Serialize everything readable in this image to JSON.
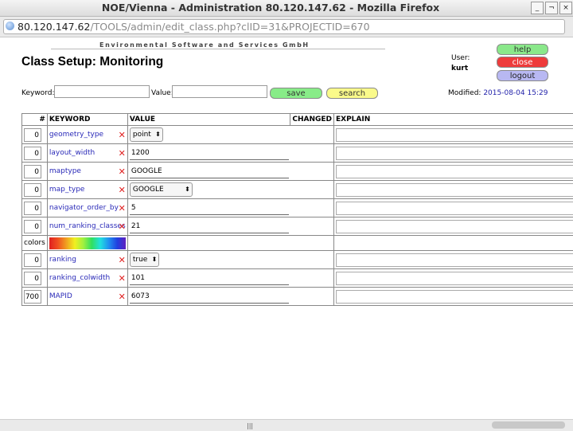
{
  "window": {
    "title": "NOE/Vienna - Administration 80.120.147.62 - Mozilla Firefox",
    "url_host": "80.120.147.62",
    "url_path": "/TOOLS/admin/edit_class.php?clID=31&PROJECTID=670",
    "controls": {
      "minimize": "_",
      "maximize": "¬",
      "close": "×"
    }
  },
  "header": {
    "company": "Environmental Software and Services GmbH",
    "title": "Class Setup: Monitoring",
    "user_label": "User:",
    "user_name": "kurt"
  },
  "buttons": {
    "help": "help",
    "close": "close",
    "logout": "logout",
    "save": "save",
    "search": "search"
  },
  "search": {
    "keyword_label": "Keyword:",
    "keyword_value": "",
    "value_label": "Value:",
    "value_value": ""
  },
  "modified": {
    "label": "Modified:",
    "date": "2015-08-04 15:29"
  },
  "table": {
    "headers": {
      "num": "#",
      "keyword": "KEYWORD",
      "value": "VALUE",
      "changed": "CHANGED",
      "explain": "EXPLAIN"
    },
    "rows": [
      {
        "order": "0",
        "keyword": "geometry_type",
        "value": "point"
      },
      {
        "order": "0",
        "keyword": "layout_width",
        "value": "1200"
      },
      {
        "order": "0",
        "keyword": "maptype",
        "value": "GOOGLE"
      },
      {
        "order": "0",
        "keyword": "map_type",
        "value": "GOOGLE"
      },
      {
        "order": "0",
        "keyword": "navigator_order_by",
        "value": "5"
      },
      {
        "order": "0",
        "keyword": "num_ranking_classes",
        "value": "21"
      },
      {
        "label": "colors"
      },
      {
        "order": "0",
        "keyword": "ranking",
        "value": "true"
      },
      {
        "order": "0",
        "keyword": "ranking_colwidth",
        "value": "101"
      },
      {
        "order": "700",
        "keyword": "MAPID",
        "value": "6073"
      }
    ],
    "delete_symbol": "✕"
  },
  "icons": {
    "site_identity": "globe-icon",
    "delete": "delete-x-icon",
    "select_arrow": "select-arrows-icon"
  },
  "colors": {
    "save": "#88ec88",
    "search": "#fafa8a",
    "help": "#8ae88a",
    "close": "#ee3b3b",
    "logout": "#b8b8f2",
    "keyword_link": "#2a2ab8",
    "delete": "#e02020"
  }
}
